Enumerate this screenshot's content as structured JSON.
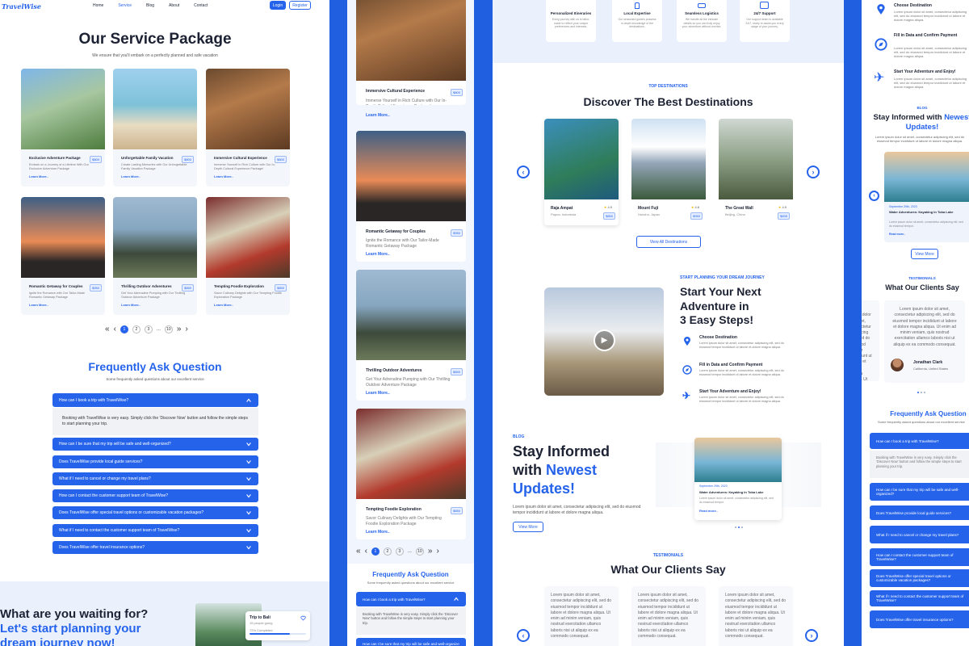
{
  "brand": "TravelWise",
  "nav": [
    "Home",
    "Service",
    "Blog",
    "About",
    "Contact"
  ],
  "auth": {
    "login": "Login",
    "register": "Register"
  },
  "service": {
    "title": "Our Service Package",
    "subtitle": "We ensure that you'll embark on a perfectly planned and safe vacation",
    "packages": [
      {
        "name": "Exclusive Adventure Package",
        "price": "$800",
        "desc": "Embark on a Journey of a Lifetime With Our Exclusive Adventure Package",
        "more": "Learn More.."
      },
      {
        "name": "Unforgettable Family Vacation",
        "price": "$800",
        "desc": "Create Lasting Memories with Our Unforgettable Family Vacation Package",
        "more": "Learn More.."
      },
      {
        "name": "Immersive Cultural Experience",
        "price": "$800",
        "desc": "Immerse Yourself in Rich Culture with Our In-Depth Cultural Experience Package!",
        "more": "Learn More.."
      },
      {
        "name": "Romantic Getaway for Couples",
        "price": "$950",
        "desc": "Ignite the Romance with Our Tailor-Made Romantic Getaway Package",
        "more": "Learn More.."
      },
      {
        "name": "Thrilling Outdoor Adventures",
        "price": "$850",
        "desc": "Get Your Adrenaline Pumping with Our Thrilling Outdoor Adventure Package",
        "more": "Learn More.."
      },
      {
        "name": "Tempting Foodie Exploration",
        "price": "$850",
        "desc": "Savor Culinary Delights with Our Tempting Foodie Exploration Package",
        "more": "Learn More.."
      }
    ],
    "pagination": [
      "«",
      "‹",
      "1",
      "2",
      "3",
      "...",
      "10",
      "»",
      "›"
    ]
  },
  "faq": {
    "title": "Frequently Ask Question",
    "subtitle": "Some frequently asked questions about our excellent service",
    "items": [
      "How can I book a trip with TravelWise?",
      "How can I be sure that my trip will be safe and well-organized?",
      "Does TravelWise provide local guide services?",
      "What if I need to cancel or change my travel plans?",
      "How can I contact the customer support team of TravelWise?",
      "Does TravelWise offer special travel options or customizable vacation packages?",
      "What if I need to contact the customer support team of TravelWise?",
      "Does TravelWise offer travel insurance options?"
    ],
    "answer": "Booking with TravelWise is very easy. Simply click the 'Discover Now' button and follow the simple steps to start planning your trip."
  },
  "cta": {
    "line1": "What are you waiting for?",
    "line2": "Let's start planning your",
    "line3": "dream journey now!",
    "trip": "Trip to Bali",
    "trip_sub": "15 people going",
    "progress_label": "72% Completed",
    "progress": 0.72
  },
  "features": [
    {
      "title": "Personalized Itineraries",
      "desc": "Every journey with us is tailor-made to reflect your unique preferences and interests."
    },
    {
      "title": "Local Expertise",
      "desc": "Our seasoned guides possess in-depth knowledge of the destinations."
    },
    {
      "title": "Seamless Logistics",
      "desc": "We handle all the intricate details so you can truly enjoy your adventure without worries."
    },
    {
      "title": "24/7 Support",
      "desc": "Our support team is available 24/7, ready to assist you every stage of your journey."
    }
  ],
  "destinations": {
    "label": "TOP DESTINATIONS",
    "title": "Discover The Best Destinations",
    "items": [
      {
        "name": "Raja Ampat",
        "loc": "Papua, Indonesia",
        "rating": "4.9",
        "price": "$850"
      },
      {
        "name": "Mount Fuji",
        "loc": "Honshu, Japan",
        "rating": "4.8",
        "price": "$950"
      },
      {
        "name": "The Great Wall",
        "loc": "Beijing, China",
        "rating": "4.9",
        "price": "$835"
      }
    ],
    "view_all": "View All Destinations"
  },
  "steps": {
    "label": "START PLANNING YOUR DREAM JOURNEY",
    "title": [
      "Start Your Next",
      "Adventure in",
      "3 Easy Steps!"
    ],
    "items": [
      {
        "title": "Choose Destination",
        "desc": "Lorem ipsum dolor sit amet, consectetur adipiscing elit, sed do eiusmod tempor incididunt ut labore et dolore magna aliqua."
      },
      {
        "title": "Fill in Data and Confirm Payment",
        "desc": "Lorem ipsum dolor sit amet, consectetur adipiscing elit, sed do eiusmod tempor incididunt ut labore et dolore magna aliqua."
      },
      {
        "title": "Start Your Adventure and Enjoy!",
        "desc": "Lorem ipsum dolor sit amet, consectetur adipiscing elit, sed do eiusmod tempor incididunt ut labore et dolore magna aliqua."
      }
    ]
  },
  "blog": {
    "label": "BLOG",
    "title1": "Stay Informed",
    "title2": "with",
    "title3": "Newest",
    "title4": "Updates!",
    "desc": "Lorem ipsum dolor sit amet, consectetur adipiscing elit, sed do eiusmod tempor incididunt ut labore et dolore magna aliqua.",
    "view_more": "View More",
    "post": {
      "date": "September 29th, 2023",
      "title": "Water Adventures: Kayaking In Toba Lake",
      "desc": "Lorem ipsum dolor sit amet, consectetur adipiscing elit, sed do eiusmod tempor.",
      "more": "Read more.."
    }
  },
  "testimonials": {
    "label": "TESTIMONIALS",
    "title": "What Our Clients Say",
    "text": "Lorem ipsum dolor sit amet, consectetur adipiscing elit, sed do eiusmod tempor incididunt ut labore et dolore magna aliqua. Ut enim ad minim veniam, quis nostrud exercitation ullamco laboris nisi ut aliquip ex ea commodo consequat.",
    "name": "Jonathan Clark",
    "location": "California, United States"
  }
}
